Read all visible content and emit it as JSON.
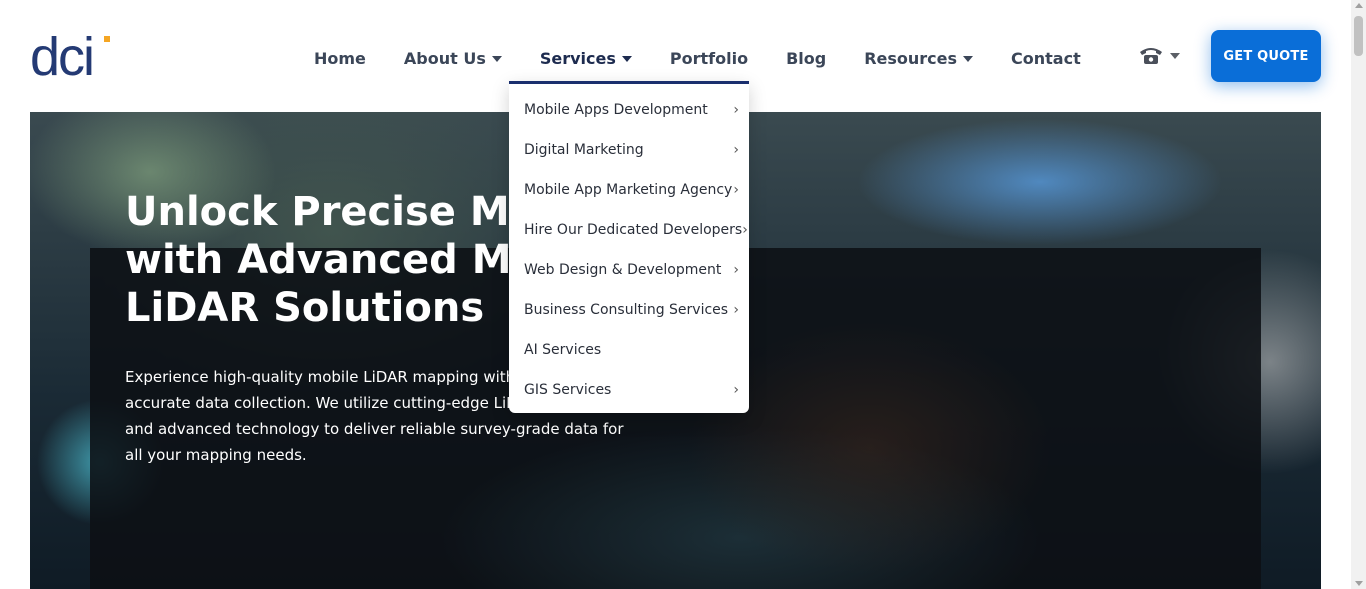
{
  "logo": {
    "text": "dci"
  },
  "nav": {
    "items": [
      {
        "label": "Home",
        "has_caret": false
      },
      {
        "label": "About Us",
        "has_caret": true
      },
      {
        "label": "Services",
        "has_caret": true
      },
      {
        "label": "Portfolio",
        "has_caret": false
      },
      {
        "label": "Blog",
        "has_caret": false
      },
      {
        "label": "Resources",
        "has_caret": true
      },
      {
        "label": "Contact",
        "has_caret": false
      }
    ],
    "active": "Services"
  },
  "phone": {
    "icon": "phone-icon"
  },
  "cta": {
    "label": "GET QUOTE",
    "color": "#0a6ed8"
  },
  "services_menu": {
    "items": [
      {
        "label": "Mobile Apps Development",
        "has_submenu": true
      },
      {
        "label": "Digital Marketing",
        "has_submenu": true
      },
      {
        "label": "Mobile App Marketing Agency",
        "has_submenu": true
      },
      {
        "label": "Hire Our Dedicated Developers",
        "has_submenu": true
      },
      {
        "label": "Web Design & Development",
        "has_submenu": true
      },
      {
        "label": "Business Consulting Services",
        "has_submenu": true
      },
      {
        "label": "AI Services",
        "has_submenu": false
      },
      {
        "label": "GIS Services",
        "has_submenu": true
      }
    ]
  },
  "hero": {
    "title": "Unlock Precise Mapping with Advanced Mobile LiDAR Solutions",
    "title_lines": [
      "Unlock Precise Map",
      "with Advanced Mo",
      "LiDAR Solutions"
    ],
    "description": "Experience high-quality mobile LiDAR mapping with fast and accurate data collection. We utilize cutting-edge LiDAR sensors and advanced technology to deliver reliable survey-grade data for all your mapping needs."
  },
  "colors": {
    "brand_navy": "#1a2f6e",
    "brand_blue": "#0a6ed8",
    "logo_orange": "#f5a623"
  }
}
